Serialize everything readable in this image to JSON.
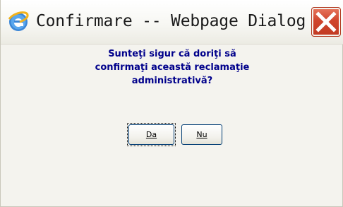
{
  "window": {
    "title": "Confirmare -- Webpage Dialog",
    "icon": "internet-explorer-icon",
    "close_icon": "close-icon"
  },
  "dialog": {
    "message_lines": [
      "Sunteţi sigur că doriţi să",
      "confirmaţi această reclamaţie",
      "administrativă?"
    ],
    "buttons": {
      "yes_label": "Da",
      "no_label": "Nu"
    }
  },
  "colors": {
    "message_text": "#00008b",
    "close_button": "#d0452d",
    "button_border": "#003c74"
  }
}
